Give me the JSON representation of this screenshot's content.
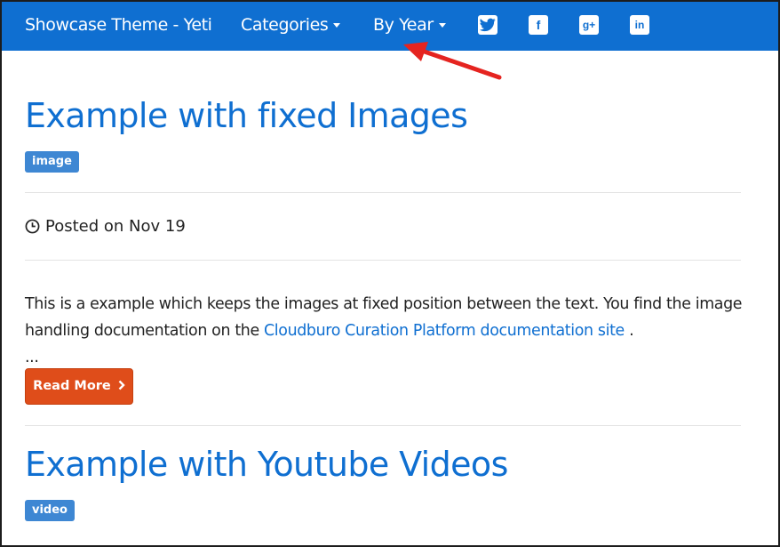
{
  "navbar": {
    "brand": "Showcase Theme - Yeti",
    "links": [
      {
        "label": "Categories",
        "dropdown": true
      },
      {
        "label": "By Year",
        "dropdown": true
      }
    ],
    "social": [
      {
        "icon": "twitter-icon"
      },
      {
        "icon": "facebook-icon",
        "glyph": "f"
      },
      {
        "icon": "google-plus-icon",
        "glyph": "g+"
      },
      {
        "icon": "linkedin-icon",
        "glyph": "in"
      }
    ],
    "bg_color": "#0f6fd1"
  },
  "annotation": {
    "icon": "red-arrow-icon",
    "color": "#e52420"
  },
  "posts": [
    {
      "title": "Example with fixed Images",
      "tag": "image",
      "posted": "Posted on Nov 19",
      "excerpt_before": "This is a example which keeps the images at fixed position between the text. You find the image handling documentation on the ",
      "excerpt_link": "Cloudburo Curation Platform documentation site",
      "excerpt_after": " .",
      "ellipsis": "...",
      "read_more": "Read More"
    },
    {
      "title": "Example with Youtube Videos",
      "tag": "video"
    }
  ],
  "colors": {
    "link": "#0f6fd1",
    "tag": "#3e87d3",
    "button": "#df4d1a"
  }
}
